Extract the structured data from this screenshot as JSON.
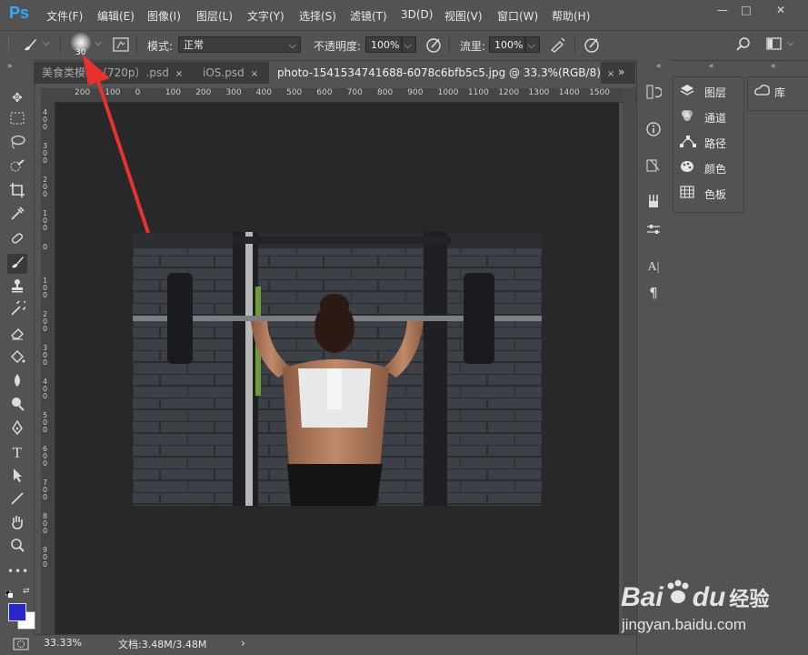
{
  "app": {
    "logo": "Ps"
  },
  "menu": [
    "文件(F)",
    "编辑(E)",
    "图像(I)",
    "图层(L)",
    "文字(Y)",
    "选择(S)",
    "滤镜(T)",
    "3D(D)",
    "视图(V)",
    "窗口(W)",
    "帮助(H)"
  ],
  "window_controls": {
    "minimize": "—",
    "maximize": "□",
    "close": "✕"
  },
  "options": {
    "brush_size": "30",
    "mode_label": "模式:",
    "mode_value": "正常",
    "opacity_label": "不透明度:",
    "opacity_value": "100%",
    "flow_label": "流里:",
    "flow_value": "100%"
  },
  "tabs": [
    {
      "label": "美食类模板（720p）.psd",
      "close": "×"
    },
    {
      "label": "iOS.psd",
      "close": "×"
    },
    {
      "label": "photo-1541534741688-6078c6bfb5c5.jpg @ 33.3%(RGB/8)",
      "close": "×"
    }
  ],
  "tab_overflow": "»",
  "ruler": {
    "h_ticks": [
      "200",
      "100",
      "0",
      "100",
      "200",
      "300",
      "400",
      "500",
      "600",
      "700",
      "800",
      "900",
      "1000",
      "1100",
      "1200",
      "1300",
      "1400",
      "1500"
    ],
    "v_ticks": [
      "400",
      "300",
      "200",
      "100",
      "0",
      "100",
      "200",
      "300",
      "400",
      "500",
      "600",
      "700",
      "800",
      "900"
    ]
  },
  "status": {
    "zoom": "33.33%",
    "doc_info": "文档:3.48M/3.48M",
    "arrow": "›"
  },
  "panels": [
    {
      "label": "图层",
      "icon": "layers-icon"
    },
    {
      "label": "通道",
      "icon": "channels-icon"
    },
    {
      "label": "路径",
      "icon": "paths-icon"
    },
    {
      "label": "颜色",
      "icon": "color-icon"
    },
    {
      "label": "色板",
      "icon": "swatches-icon"
    }
  ],
  "library": {
    "label": "库",
    "icon": "libraries-icon"
  },
  "colors": {
    "foreground": "#2a27c8",
    "background": "#ffffff",
    "arrow": "#e8322f",
    "accent": "#31a8ff"
  },
  "watermark": {
    "brand": "Bai",
    "du": "du",
    "cn": "经验",
    "url": "jingyan.baidu.com"
  }
}
